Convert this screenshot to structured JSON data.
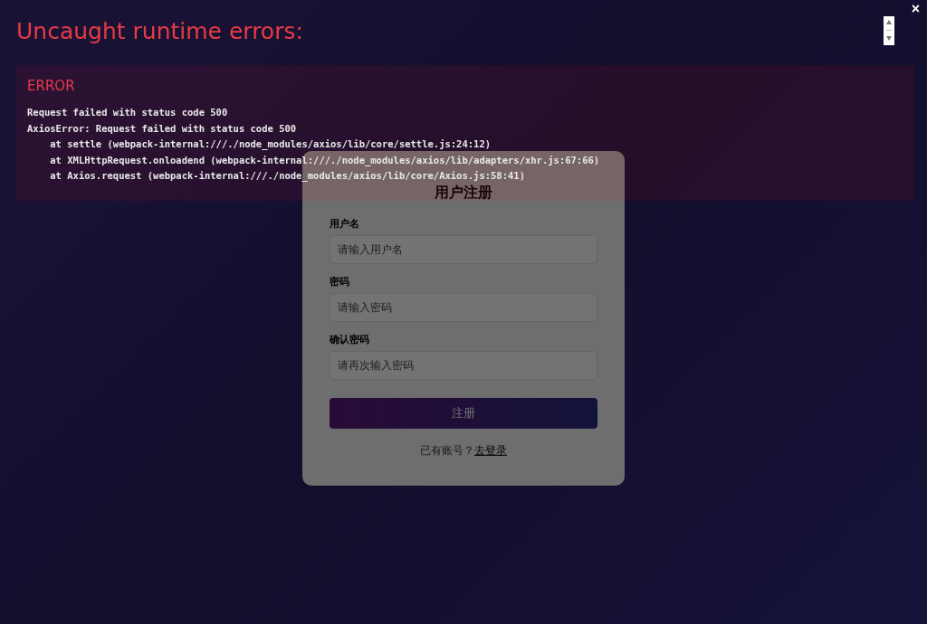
{
  "form": {
    "title": "用户注册",
    "fields": [
      {
        "label": "用户名",
        "placeholder": "请输入用户名"
      },
      {
        "label": "密码",
        "placeholder": "请输入密码"
      },
      {
        "label": "确认密码",
        "placeholder": "请再次输入密码"
      }
    ],
    "submit": "注册",
    "footer": {
      "text": "已有账号？",
      "link": "去登录"
    }
  },
  "overlay": {
    "title": "Uncaught runtime errors:",
    "close": "×",
    "error": {
      "heading": "ERROR",
      "lines": [
        "Request failed with status code 500",
        "AxiosError: Request failed with status code 500",
        "    at settle (webpack-internal:///./node_modules/axios/lib/core/settle.js:24:12)",
        "    at XMLHttpRequest.onloadend (webpack-internal:///./node_modules/axios/lib/adapters/xhr.js:67:66)",
        "    at Axios.request (webpack-internal:///./node_modules/axios/lib/core/Axios.js:58:41)"
      ]
    }
  }
}
